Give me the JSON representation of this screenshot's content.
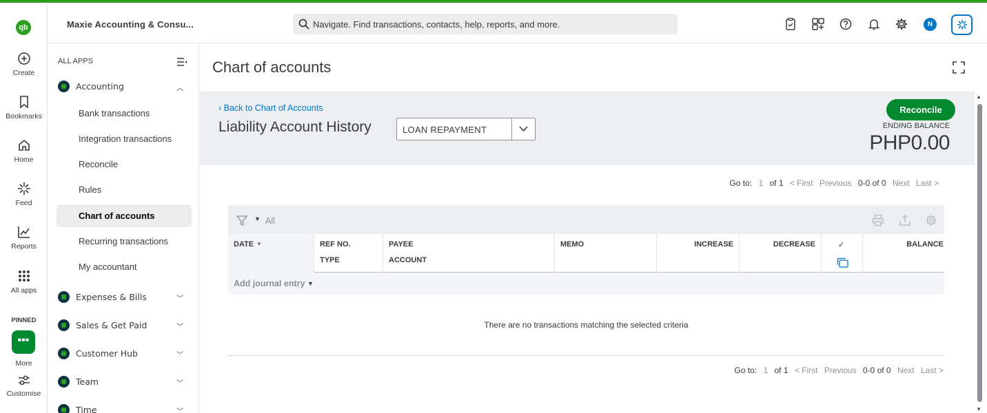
{
  "brand": {
    "accent": "#2ca01c",
    "primary_button": "#00892e",
    "link": "#0077c5"
  },
  "rail": {
    "items": [
      {
        "label": "Create",
        "icon": "plus-circle-icon"
      },
      {
        "label": "Bookmarks",
        "icon": "bookmark-icon"
      },
      {
        "label": "Home",
        "icon": "home-icon"
      },
      {
        "label": "Feed",
        "icon": "sparkle-icon"
      },
      {
        "label": "Reports",
        "icon": "chart-line-icon"
      },
      {
        "label": "All apps",
        "icon": "grid-dots-icon"
      }
    ],
    "pinned_label": "PINNED",
    "more_label": "More",
    "customise_label": "Customise"
  },
  "header": {
    "company": "Maxie Accounting & Consu...",
    "search_placeholder": "Navigate. Find transactions, contacts, help, reports, and more.",
    "avatar_initial": "N"
  },
  "sidenav": {
    "all_apps_label": "ALL APPS",
    "accounting": {
      "label": "Accounting",
      "items": [
        "Bank transactions",
        "Integration transactions",
        "Reconcile",
        "Rules",
        "Chart of accounts",
        "Recurring transactions",
        "My accountant"
      ],
      "active": "Chart of accounts"
    },
    "apps": [
      "Expenses & Bills",
      "Sales & Get Paid",
      "Customer Hub",
      "Team",
      "Time"
    ]
  },
  "page": {
    "title": "Chart of accounts",
    "back_link": "Back to Chart of Accounts",
    "history_title": "Liability Account History",
    "account_selected": "LOAN REPAYMENT",
    "reconcile_label": "Reconcile",
    "ending_balance_label": "ENDING BALANCE",
    "ending_balance_value": "PHP0.00"
  },
  "pager_top": {
    "goto": "Go to:",
    "page": "1",
    "of": "of 1",
    "first": "< First",
    "previous": "Previous",
    "range": "0-0 of 0",
    "next": "Next",
    "last": "Last >"
  },
  "pager_bottom": {
    "goto": "Go to:",
    "page": "1",
    "of": "of 1",
    "first": "< First",
    "previous": "Previous",
    "range": "0-0 of 0",
    "next": "Next",
    "last": "Last >"
  },
  "table": {
    "filter_value": "All",
    "columns": {
      "date": "DATE",
      "ref_no": "REF NO.",
      "type": "TYPE",
      "payee": "PAYEE",
      "account": "ACCOUNT",
      "memo": "MEMO",
      "increase": "INCREASE",
      "decrease": "DECREASE",
      "cleared": "✓",
      "balance": "BALANCE"
    },
    "add_entry_label": "Add journal entry",
    "empty_message": "There are no transactions matching the selected criteria"
  }
}
